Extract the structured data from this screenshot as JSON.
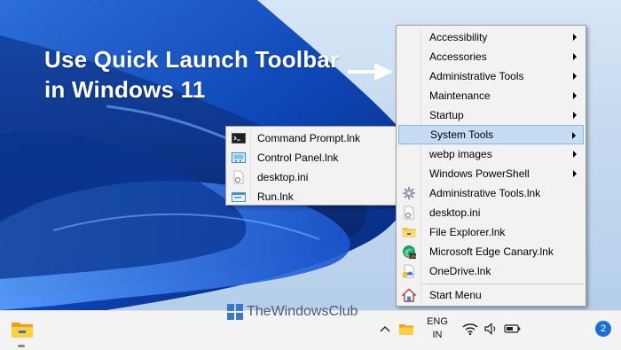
{
  "headline": {
    "line1": "Use Quick Launch Toolbar",
    "line2": "in Windows 11"
  },
  "main_menu": {
    "items": [
      {
        "label": "Accessibility",
        "icon": "none",
        "submenu": true
      },
      {
        "label": "Accessories",
        "icon": "none",
        "submenu": true
      },
      {
        "label": "Administrative Tools",
        "icon": "none",
        "submenu": true
      },
      {
        "label": "Maintenance",
        "icon": "none",
        "submenu": true
      },
      {
        "label": "Startup",
        "icon": "none",
        "submenu": true
      },
      {
        "label": "System Tools",
        "icon": "none",
        "submenu": true,
        "highlighted": true
      },
      {
        "label": "webp images",
        "icon": "none",
        "submenu": true
      },
      {
        "label": "Windows PowerShell",
        "icon": "none",
        "submenu": true
      },
      {
        "label": "Administrative Tools.lnk",
        "icon": "gear-shortcut-icon"
      },
      {
        "label": "desktop.ini",
        "icon": "settings-file-icon"
      },
      {
        "label": "File Explorer.lnk",
        "icon": "folder-icon"
      },
      {
        "label": "Microsoft Edge Canary.lnk",
        "icon": "edge-canary-icon"
      },
      {
        "label": "OneDrive.lnk",
        "icon": "onedrive-icon"
      }
    ],
    "start_menu": {
      "label": "Start Menu",
      "icon": "home-icon"
    }
  },
  "sub_menu": {
    "items": [
      {
        "label": "Command Prompt.lnk",
        "icon": "cmd-icon"
      },
      {
        "label": "Control Panel.lnk",
        "icon": "control-panel-icon"
      },
      {
        "label": "desktop.ini",
        "icon": "settings-file-icon"
      },
      {
        "label": "Run.lnk",
        "icon": "run-icon"
      }
    ]
  },
  "watermark": {
    "text": "TheWindowsClub"
  },
  "taskbar": {
    "lang_line1": "ENG",
    "lang_line2": "IN",
    "notification_count": "2",
    "icons": [
      "file-explorer-icon",
      "chevron-up-icon",
      "quick-launch-folder-icon",
      "wifi-icon",
      "volume-icon",
      "battery-icon"
    ]
  },
  "colors": {
    "highlight": "#c6dcf3",
    "menu_bg": "#f2f2f2",
    "accent": "#1a6fd6"
  }
}
